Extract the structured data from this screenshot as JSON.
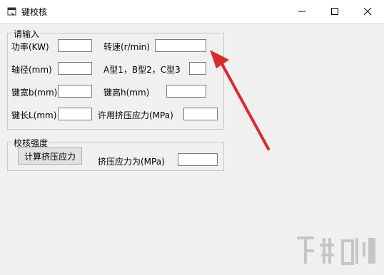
{
  "window": {
    "title": "键校核",
    "minimize_glyph": "—",
    "maximize_glyph": "☐",
    "close_glyph": "✕"
  },
  "input_group": {
    "title": "请输入",
    "power_label": "功率(KW)",
    "power_value": "",
    "speed_label": "转速(r/min)",
    "speed_value": "",
    "diameter_label": "轴径(mm)",
    "diameter_value": "",
    "type_label": "A型1，B型2，C型3",
    "type_value": "",
    "width_label": "键宽b(mm)",
    "width_value": "",
    "height_label": "键高h(mm)",
    "height_value": "",
    "length_label": "键长L(mm)",
    "length_value": "",
    "allow_stress_label": "许用挤压应力(MPa)",
    "allow_stress_value": ""
  },
  "check_group": {
    "title": "校核强度",
    "calc_button": "计算挤压应力",
    "result_label": "挤压应力为(MPa)",
    "result_value": ""
  },
  "annotation": {
    "color": "#d92b2b"
  },
  "icons": {
    "app": "window-app-icon",
    "watermark": "watermark-logo"
  }
}
